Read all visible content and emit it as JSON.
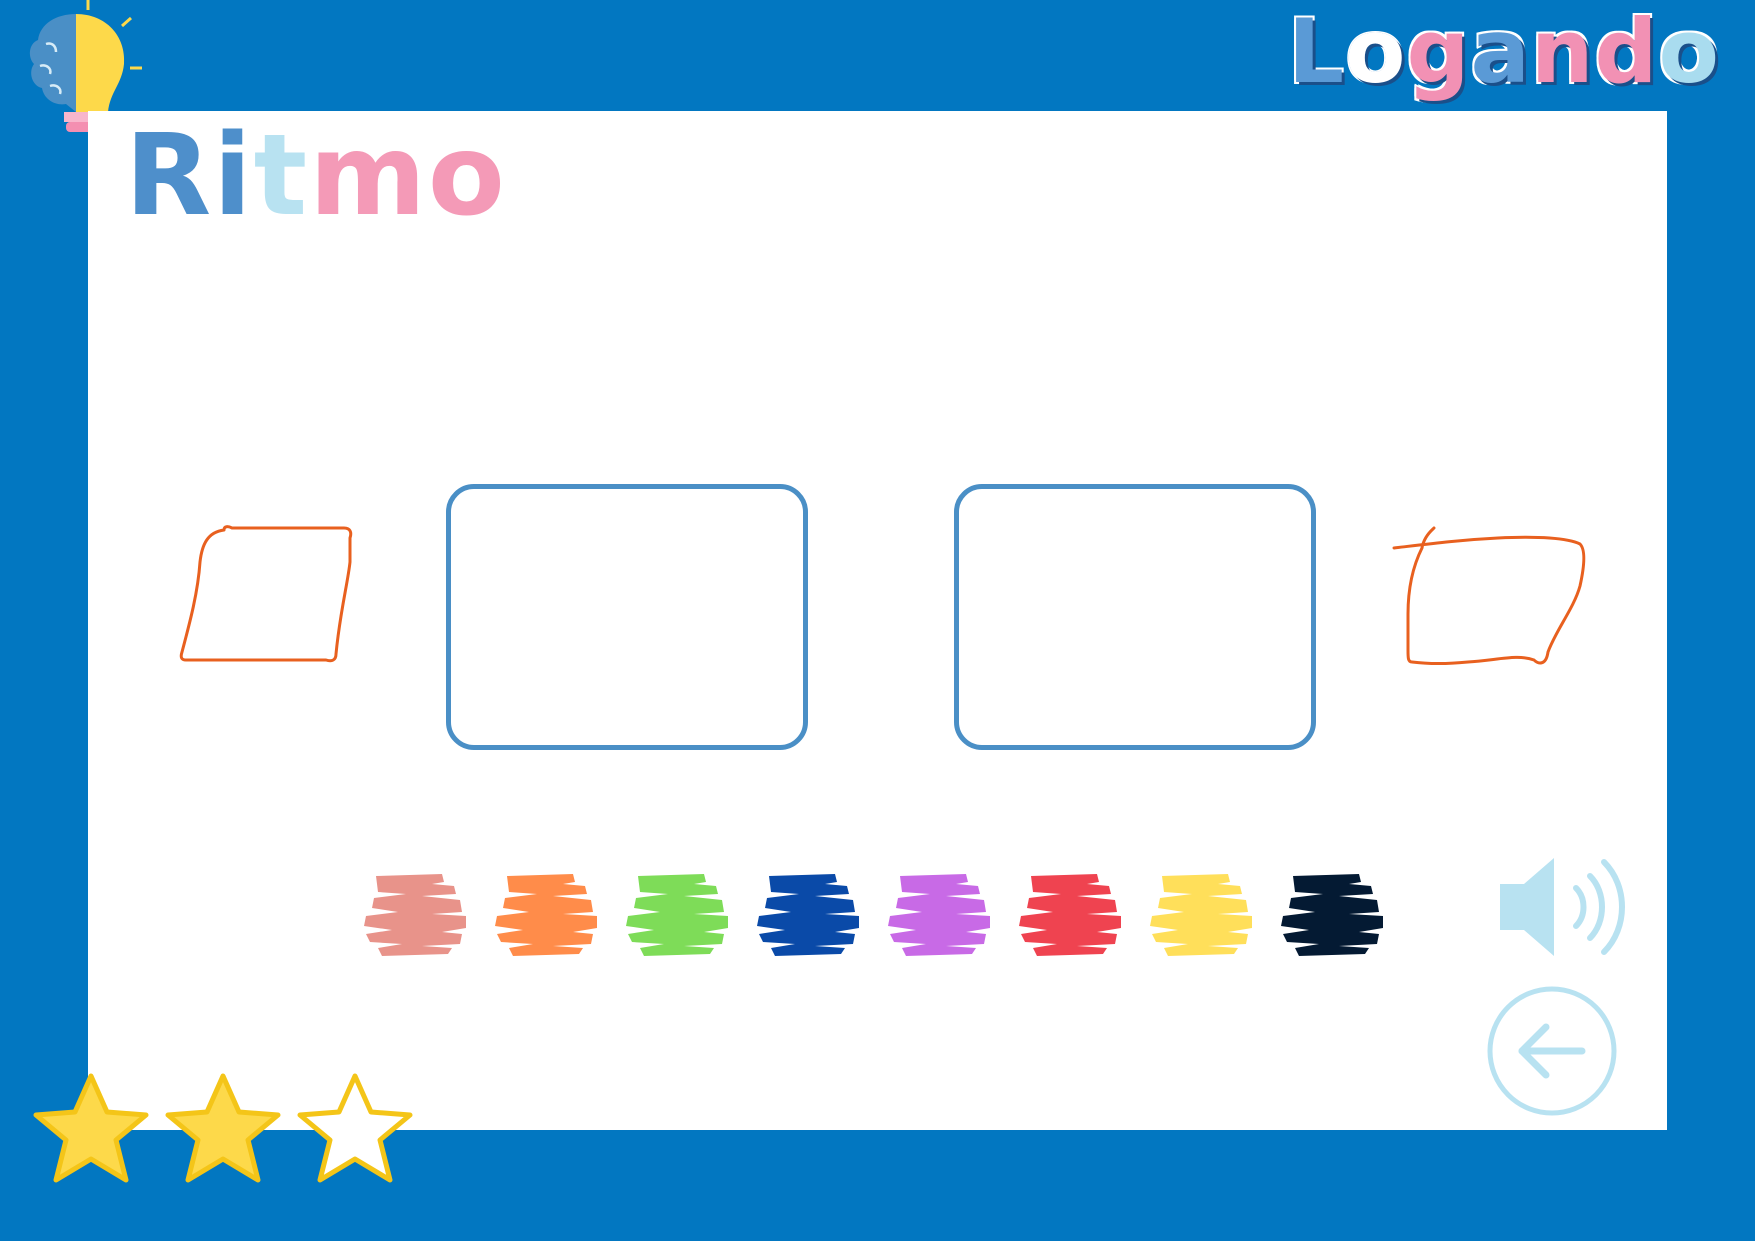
{
  "logo": {
    "letters": [
      {
        "char": "L",
        "color": "#5a9ad6"
      },
      {
        "char": "o",
        "color": "#ffffff"
      },
      {
        "char": "g",
        "color": "#f291b4"
      },
      {
        "char": "a",
        "color": "#5a9ad6"
      },
      {
        "char": "n",
        "color": "#f291b4"
      },
      {
        "char": "d",
        "color": "#f291b4"
      },
      {
        "char": "o",
        "color": "#a9dcef"
      }
    ]
  },
  "title": {
    "letters": [
      {
        "char": "R",
        "color": "#4e8fcb"
      },
      {
        "char": "i",
        "color": "#4e8fcb"
      },
      {
        "char": "t",
        "color": "#b8e2f1"
      },
      {
        "char": "m",
        "color": "#f49ab7"
      },
      {
        "char": "o",
        "color": "#f49ab7"
      }
    ]
  },
  "pattern": {
    "left_shape": "orange-parallelogram-icon",
    "right_shape": "orange-parallelogram-icon",
    "stroke_color": "#e8601f",
    "answer_slots": 2
  },
  "palette": {
    "colors": [
      "#e8938a",
      "#ff8c4a",
      "#7edc58",
      "#0a4aa8",
      "#c86ae6",
      "#ef4350",
      "#ffdf5a",
      "#041a33"
    ]
  },
  "controls": {
    "sound_icon": "speaker-icon",
    "back_icon": "back-arrow-icon",
    "accent": "#b8e2f1"
  },
  "rating": {
    "filled": 2,
    "total": 3,
    "fill_color": "#fdd94a",
    "outline_color": "#f4c518"
  }
}
